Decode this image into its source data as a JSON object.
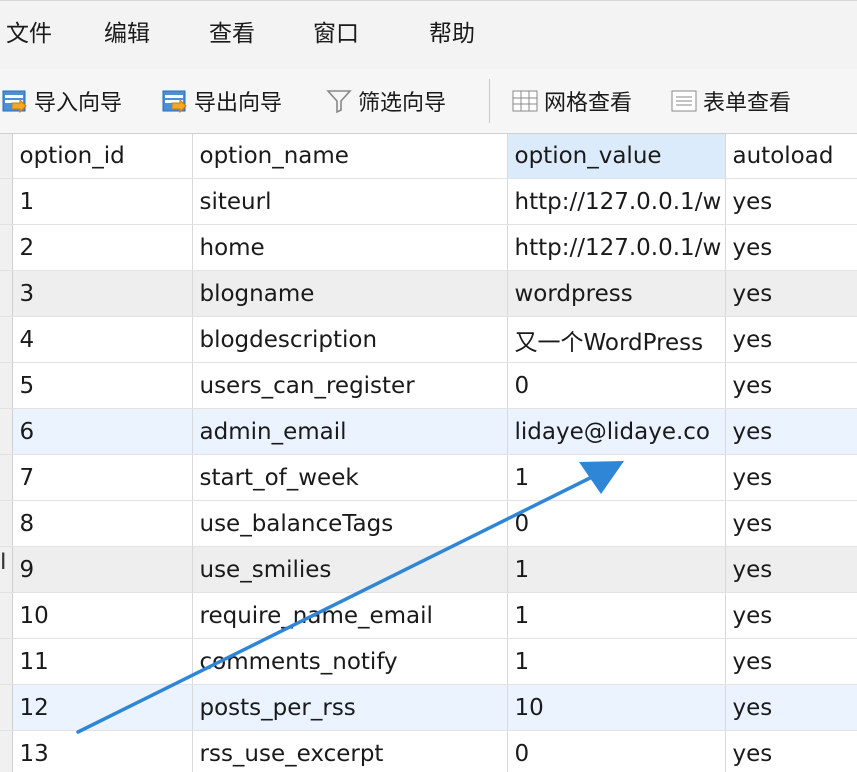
{
  "menu": [
    "文件",
    "编辑",
    "查看",
    "窗口",
    "帮助"
  ],
  "toolbar": {
    "import_label": "导入向导",
    "export_label": "导出向导",
    "filter_label": "筛选向导",
    "grid_view_label": "网格查看",
    "form_view_label": "表单查看"
  },
  "table": {
    "columns": [
      "option_id",
      "option_name",
      "option_value",
      "autoload"
    ],
    "rows": [
      [
        "1",
        "siteurl",
        "http://127.0.0.1/w",
        "yes"
      ],
      [
        "2",
        "home",
        "http://127.0.0.1/w",
        "yes"
      ],
      [
        "3",
        "blogname",
        "wordpress",
        "yes"
      ],
      [
        "4",
        "blogdescription",
        "又一个WordPress",
        "yes"
      ],
      [
        "5",
        "users_can_register",
        "0",
        "yes"
      ],
      [
        "6",
        "admin_email",
        "lidaye@lidaye.co",
        "yes"
      ],
      [
        "7",
        "start_of_week",
        "1",
        "yes"
      ],
      [
        "8",
        "use_balanceTags",
        "0",
        "yes"
      ],
      [
        "9",
        "use_smilies",
        "1",
        "yes"
      ],
      [
        "10",
        "require_name_email",
        "1",
        "yes"
      ],
      [
        "11",
        "comments_notify",
        "1",
        "yes"
      ],
      [
        "12",
        "posts_per_rss",
        "10",
        "yes"
      ],
      [
        "13",
        "rss_use_excerpt",
        "0",
        "yes"
      ]
    ]
  },
  "colors": {
    "arrow": "#2f86d6",
    "selected_header": "#dcebfb",
    "row_highlight": "#eaf3ff"
  }
}
